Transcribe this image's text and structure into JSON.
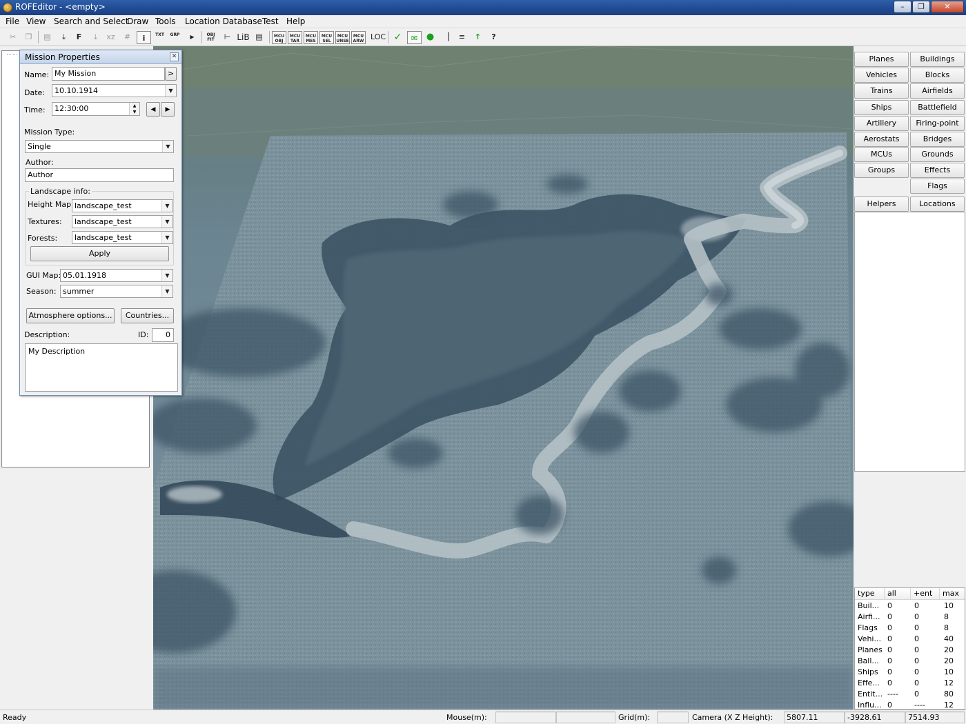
{
  "window": {
    "title": "ROFEditor - <empty>"
  },
  "menu": [
    "File",
    "View",
    "Search and Select",
    "Draw",
    "Tools",
    "Location Database",
    "Test",
    "Help"
  ],
  "toolbar": {
    "txt_label": "TXT",
    "grp_label": "GRP",
    "obj_fit_label": "OBJ FIT",
    "lib_label": "LiB",
    "mcu_obj": "MCU OBJ",
    "mcu_tar": "MCU TAR",
    "mcu_mes": "MCU MES",
    "mcu_sel": "MCU SEL",
    "mcu_unse": "MCU UNSE",
    "mcu_arw": "MCU ARW",
    "loc_label": "LOC"
  },
  "mission_dialog": {
    "title": "Mission Properties",
    "name_label": "Name:",
    "name_value": "My Mission",
    "name_button": ">",
    "date_label": "Date:",
    "date_value": "10.10.1914",
    "time_label": "Time:",
    "time_value": "12:30:00",
    "mission_type_label": "Mission Type:",
    "mission_type_value": "Single",
    "author_label": "Author:",
    "author_value": "Author",
    "landscape_label": "Landscape info:",
    "height_map_label": "Height Map:",
    "height_map_value": "landscape_test",
    "textures_label": "Textures:",
    "textures_value": "landscape_test",
    "forests_label": "Forests:",
    "forests_value": "landscape_test",
    "apply_label": "Apply",
    "gui_map_label": "GUI Map:",
    "gui_map_value": "05.01.1918",
    "season_label": "Season:",
    "season_value": "summer",
    "atmosphere_label": "Atmosphere options...",
    "countries_label": "Countries...",
    "description_label": "Description:",
    "id_label": "ID:",
    "id_value": "0",
    "description_value": "My Description"
  },
  "right_panel": {
    "buttons": [
      [
        "Planes",
        "Buildings"
      ],
      [
        "Vehicles",
        "Blocks"
      ],
      [
        "Trains",
        "Airfields"
      ],
      [
        "Ships",
        "Battlefield"
      ],
      [
        "Artillery",
        "Firing-point"
      ],
      [
        "Aerostats",
        "Bridges"
      ],
      [
        "MCUs",
        "Grounds"
      ],
      [
        "Groups",
        "Effects"
      ],
      [
        "",
        "Flags"
      ],
      [
        "Helpers",
        "Locations"
      ]
    ],
    "stats_headers": [
      "type",
      "all",
      "+ent",
      "max"
    ],
    "stats_rows": [
      [
        "Buil...",
        "0",
        "0",
        "10"
      ],
      [
        "Airfi...",
        "0",
        "0",
        "8"
      ],
      [
        "Flags",
        "0",
        "0",
        "8"
      ],
      [
        "Vehi...",
        "0",
        "0",
        "40"
      ],
      [
        "Planes",
        "0",
        "0",
        "20"
      ],
      [
        "Ball...",
        "0",
        "0",
        "20"
      ],
      [
        "Ships",
        "0",
        "0",
        "10"
      ],
      [
        "Effe...",
        "0",
        "0",
        "12"
      ],
      [
        "Entit...",
        "----",
        "0",
        "80"
      ],
      [
        "Influ...",
        "0",
        "----",
        "12"
      ]
    ]
  },
  "status": {
    "ready": "Ready",
    "mouse_label": "Mouse(m):",
    "grid_label": "Grid(m):",
    "camera_label": "Camera (X Z Height):",
    "camera_x": "5807.11",
    "camera_z": "-3928.61",
    "camera_h": "7514.93"
  },
  "icons": [
    "cut-icon",
    "copy-icon",
    "paste-icon",
    "download-icon",
    "snap-icon",
    "info-icon",
    "play-icon",
    "check-icon",
    "envelope-icon",
    "dot-icon",
    "arrow-up-icon",
    "help-icon"
  ]
}
